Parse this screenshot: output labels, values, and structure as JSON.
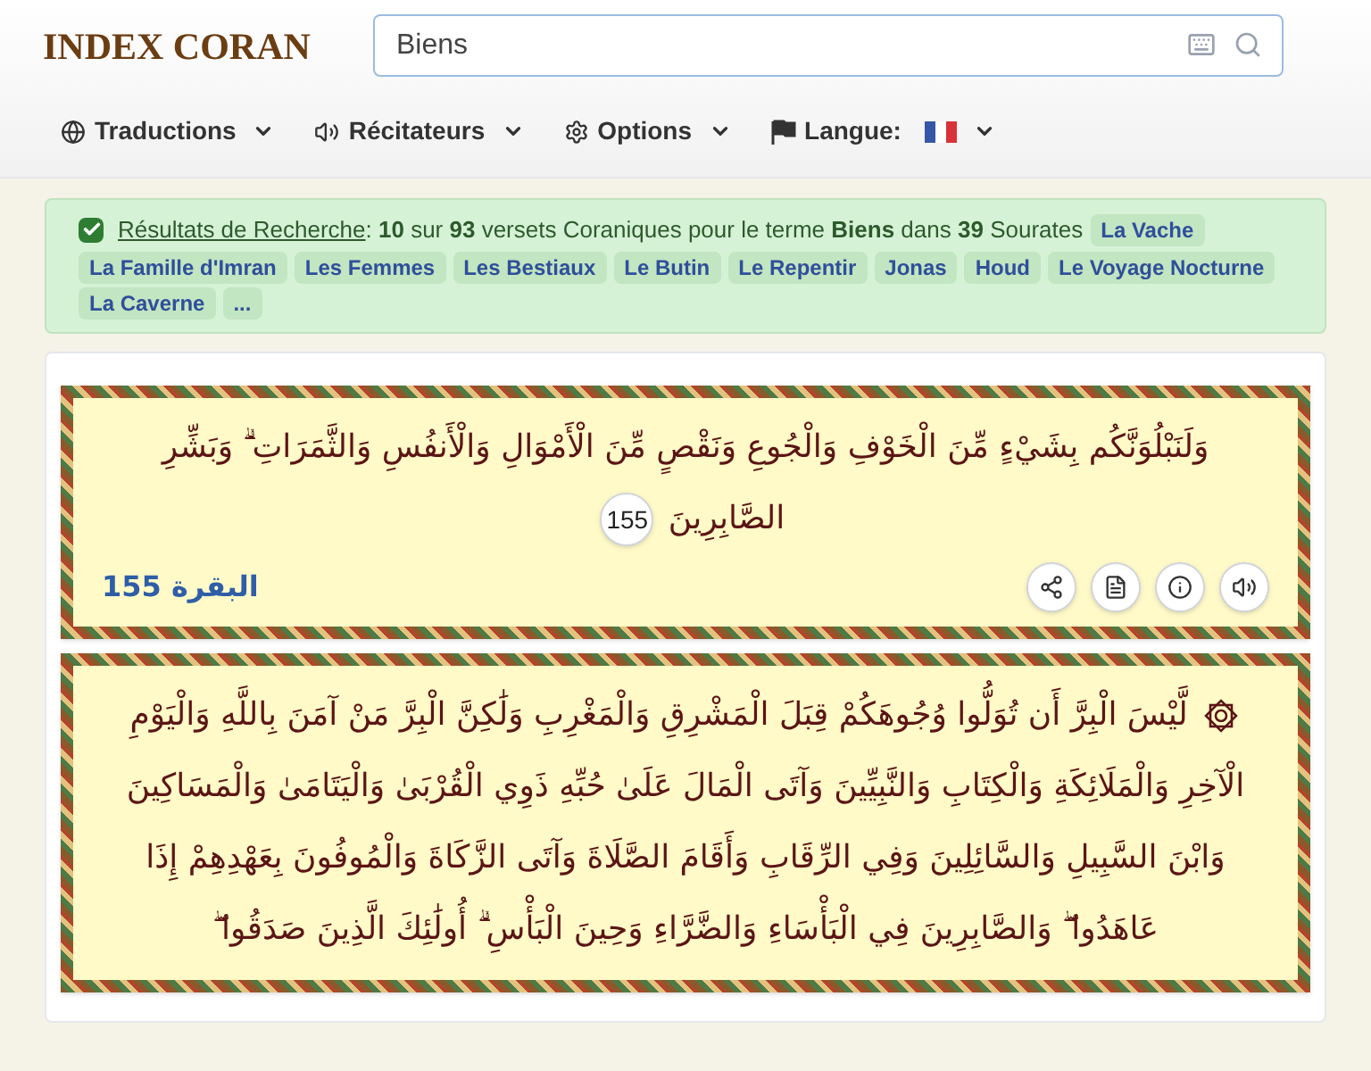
{
  "header": {
    "logo": "INDEX CORAN",
    "search": {
      "value": "Biens"
    }
  },
  "nav": [
    {
      "kind": "globe",
      "label": "Traductions"
    },
    {
      "kind": "speaker",
      "label": "Récitateurs"
    },
    {
      "kind": "gear",
      "label": "Options"
    },
    {
      "kind": "flag",
      "label": "Langue:"
    }
  ],
  "results": {
    "checked": true,
    "link": "Résultats de Recherche",
    "summary": ": **10** sur **93** versets Coraniques pour le terme **Biens** dans **39** Sourates",
    "tags": [
      "La Vache",
      "La Famille d'Imran",
      "Les Femmes",
      "Les Bestiaux",
      "Le Butin",
      "Le Repentir",
      "Jonas",
      "Houd",
      "Le Voyage Nocturne",
      "La Caverne",
      "..."
    ]
  },
  "verses": [
    {
      "hizb_mark": false,
      "text": "وَلَنَبْلُوَنَّكُم بِشَيْءٍ مِّنَ الْخَوْفِ وَالْجُوعِ وَنَقْصٍ مِّنَ الْأَمْوَالِ وَالْأَنفُسِ وَالثَّمَرَاتِ ۗ وَبَشِّرِ الصَّابِرِينَ",
      "number": "155",
      "reference": "البقرة 155"
    },
    {
      "hizb_mark": true,
      "text": "لَّيْسَ الْبِرَّ أَن تُوَلُّوا وُجُوهَكُمْ قِبَلَ الْمَشْرِقِ وَالْمَغْرِبِ وَلَٰكِنَّ الْبِرَّ مَنْ آمَنَ بِاللَّهِ وَالْيَوْمِ الْآخِرِ وَالْمَلَائِكَةِ وَالْكِتَابِ وَالنَّبِيِّينَ وَآتَى الْمَالَ عَلَىٰ حُبِّهِ ذَوِي الْقُرْبَىٰ وَالْيَتَامَىٰ وَالْمَسَاكِينَ وَابْنَ السَّبِيلِ وَالسَّائِلِينَ وَفِي الرِّقَابِ وَأَقَامَ الصَّلَاةَ وَآتَى الزَّكَاةَ وَالْمُوفُونَ بِعَهْدِهِمْ إِذَا عَاهَدُوا ۖ وَالصَّابِرِينَ فِي الْبَأْسَاءِ وَالضَّرَّاءِ وَحِينَ الْبَأْسِ ۗ أُولَٰئِكَ الَّذِينَ صَدَقُوا ۖ"
    }
  ]
}
